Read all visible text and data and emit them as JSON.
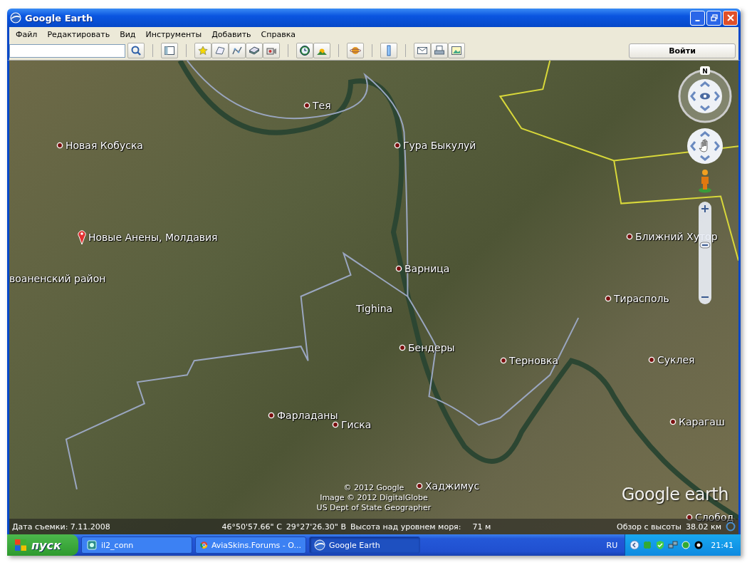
{
  "window": {
    "title": "Google Earth"
  },
  "menu": [
    "Файл",
    "Редактировать",
    "Вид",
    "Инструменты",
    "Добавить",
    "Справка"
  ],
  "toolbar": {
    "login_button": "Войти"
  },
  "map": {
    "places": [
      {
        "name": "Тея",
        "kind": "town"
      },
      {
        "name": "Новая Кобуска",
        "kind": "town"
      },
      {
        "name": "Гура Быкулуй",
        "kind": "town"
      },
      {
        "name": "Новые Анены, Молдавия",
        "kind": "pin"
      },
      {
        "name": "воаненский район",
        "kind": "area"
      },
      {
        "name": "Варница",
        "kind": "town"
      },
      {
        "name": "Tighina",
        "kind": "area"
      },
      {
        "name": "Ближний Хутор",
        "kind": "town"
      },
      {
        "name": "Тирасполь",
        "kind": "town"
      },
      {
        "name": "Бендеры",
        "kind": "town"
      },
      {
        "name": "Терновка",
        "kind": "town"
      },
      {
        "name": "Суклея",
        "kind": "town"
      },
      {
        "name": "Фарладаны",
        "kind": "town"
      },
      {
        "name": "Гиска",
        "kind": "town"
      },
      {
        "name": "Карагаш",
        "kind": "town"
      },
      {
        "name": "Хаджимус",
        "kind": "town"
      },
      {
        "name": "Слобод",
        "kind": "town"
      }
    ],
    "compass_north": "N",
    "zoom_slider": {
      "level": 0.6
    },
    "credits": [
      "© 2012 Google",
      "Image © 2012 DigitalGlobe",
      "US Dept of State Geographer"
    ],
    "logo": "Google earth"
  },
  "status_bar": {
    "imagery_date": "Дата съемки: 7.11.2008",
    "latitude": "46°50'57.66\" С",
    "longitude": "29°27'26.30\" В",
    "elevation_label": "Высота над уровнем моря:",
    "elevation": "71 м",
    "eye_alt_label": "Обзор с высоты",
    "eye_alt": "38.02 км"
  },
  "taskbar": {
    "start": "пуск",
    "tasks": [
      {
        "label": "il2_conn",
        "selected": false
      },
      {
        "label": "AviaSkins.Forums - O...",
        "selected": false
      },
      {
        "label": "Google Earth",
        "selected": true
      }
    ],
    "language": "RU",
    "clock": "21:41"
  }
}
